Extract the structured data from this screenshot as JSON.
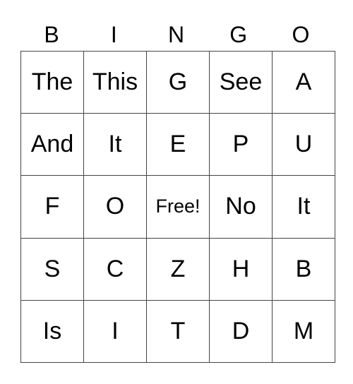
{
  "header": [
    "B",
    "I",
    "N",
    "G",
    "O"
  ],
  "rows": [
    [
      "The",
      "This",
      "G",
      "See",
      "A"
    ],
    [
      "And",
      "It",
      "E",
      "P",
      "U"
    ],
    [
      "F",
      "O",
      "Free!",
      "No",
      "It"
    ],
    [
      "S",
      "C",
      "Z",
      "H",
      "B"
    ],
    [
      "Is",
      "I",
      "T",
      "D",
      "M"
    ]
  ]
}
